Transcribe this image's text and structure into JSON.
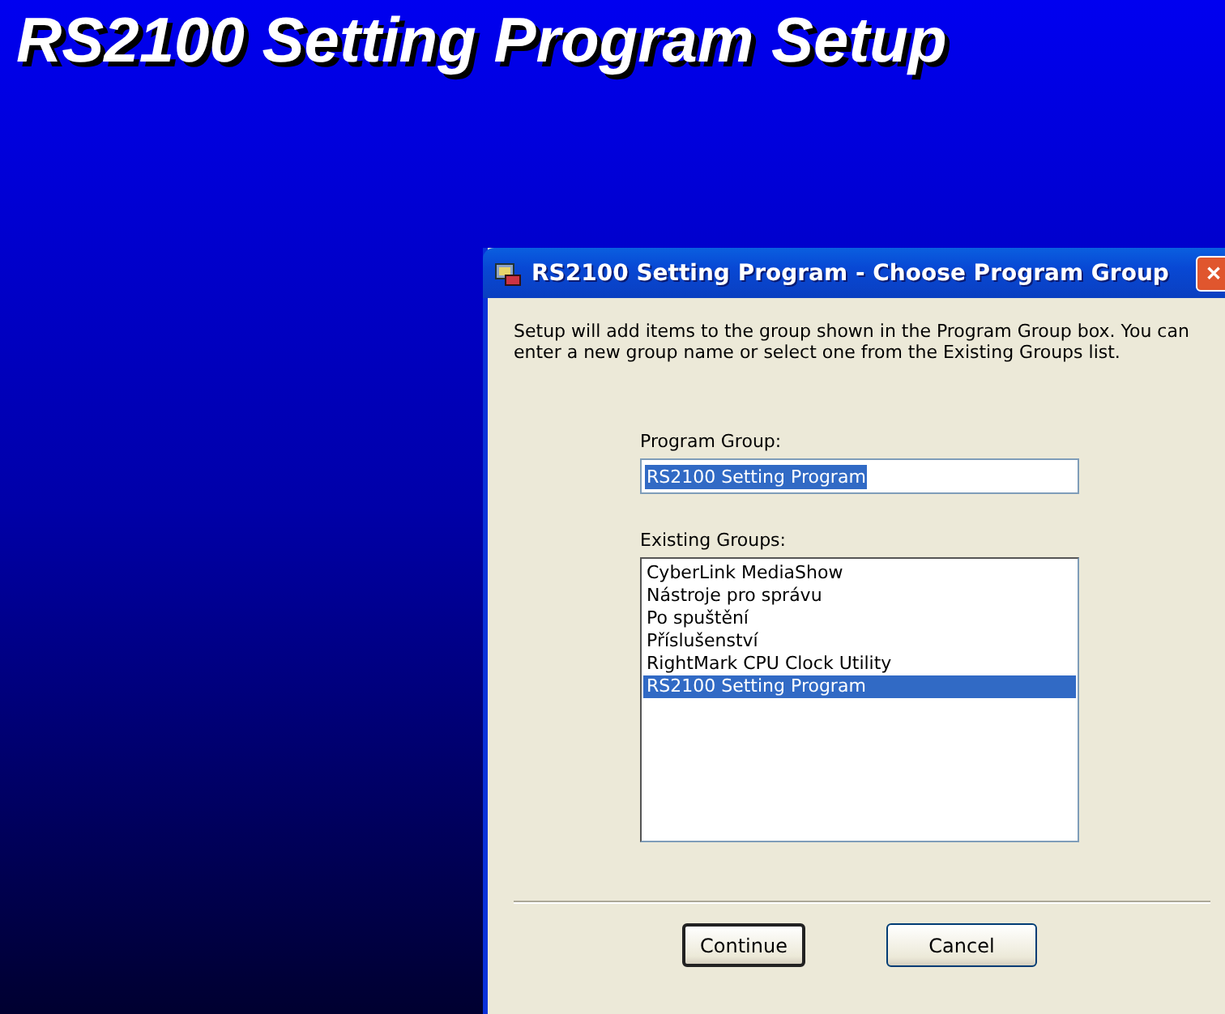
{
  "setup_title": "RS2100 Setting Program Setup",
  "window": {
    "title": "RS2100 Setting Program - Choose Program Group",
    "close": "✕"
  },
  "intro": "Setup will add items to the group shown in the Program Group box. You can enter a new group name or select one from the Existing Groups list.",
  "program_group": {
    "label": "Program Group:",
    "value": "RS2100 Setting Program"
  },
  "existing_groups": {
    "label": "Existing Groups:",
    "items": [
      {
        "label": "CyberLink MediaShow",
        "selected": false
      },
      {
        "label": "Nástroje pro správu",
        "selected": false
      },
      {
        "label": "Po spuštění",
        "selected": false
      },
      {
        "label": "Příslušenství",
        "selected": false
      },
      {
        "label": "RightMark CPU Clock Utility",
        "selected": false
      },
      {
        "label": "RS2100 Setting Program",
        "selected": true
      }
    ]
  },
  "buttons": [
    {
      "label": "Continue",
      "default": true
    },
    {
      "label": "Cancel",
      "default": false
    }
  ]
}
